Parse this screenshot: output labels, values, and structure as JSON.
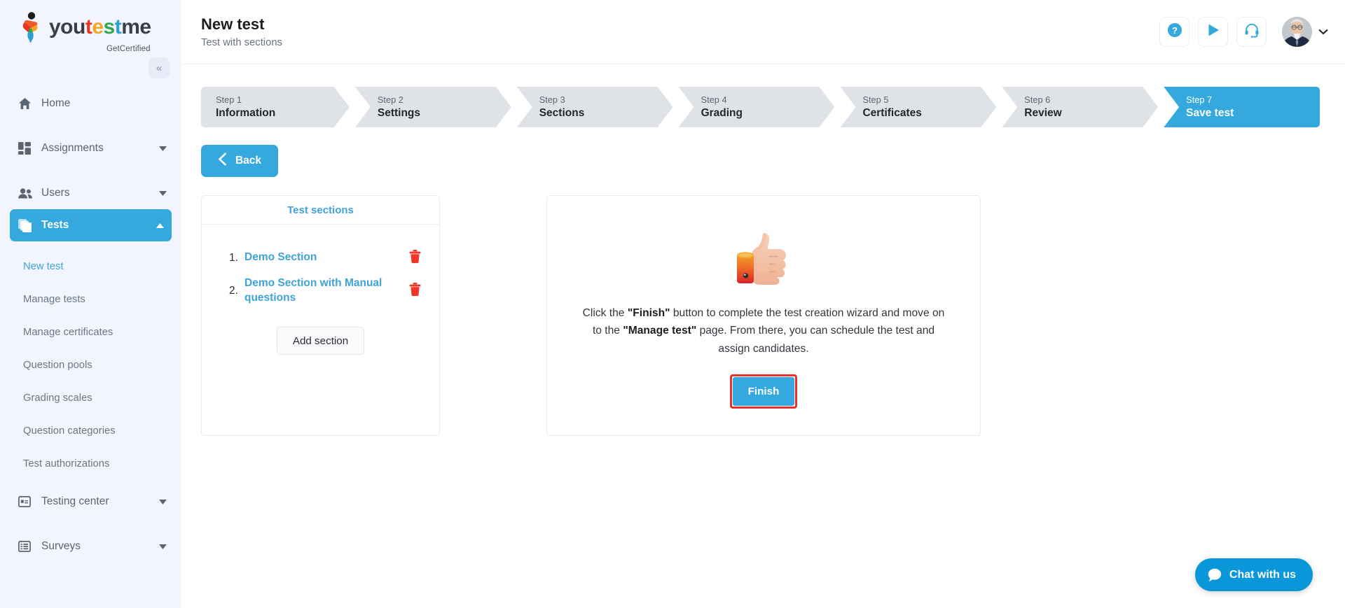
{
  "brand": {
    "name_parts": [
      {
        "text": "you",
        "color": "#3b3f45"
      },
      {
        "text": "t",
        "color": "#ea3323"
      },
      {
        "text": "e",
        "color": "#f5a623"
      },
      {
        "text": "s",
        "color": "#2fa84f"
      },
      {
        "text": "t",
        "color": "#2e9fd4"
      },
      {
        "text": "me",
        "color": "#3b3f45"
      }
    ],
    "tagline": "GetCertified",
    "collapse_icon": "chevron-double-left-icon"
  },
  "sidebar": {
    "items": [
      {
        "label": "Home",
        "icon": "home-icon",
        "has_caret": false,
        "active": false
      },
      {
        "label": "Assignments",
        "icon": "assignments-grid-icon",
        "has_caret": true,
        "active": false
      },
      {
        "label": "Users",
        "icon": "users-icon",
        "has_caret": true,
        "active": false
      },
      {
        "label": "Tests",
        "icon": "tests-stack-icon",
        "has_caret": true,
        "active": true
      }
    ],
    "sub_items": [
      {
        "label": "New test",
        "selected": true
      },
      {
        "label": "Manage tests",
        "selected": false
      },
      {
        "label": "Manage certificates",
        "selected": false
      },
      {
        "label": "Question pools",
        "selected": false
      },
      {
        "label": "Grading scales",
        "selected": false
      },
      {
        "label": "Question categories",
        "selected": false
      },
      {
        "label": "Test authorizations",
        "selected": false
      }
    ],
    "bottom_items": [
      {
        "label": "Testing center",
        "icon": "testing-center-icon",
        "has_caret": true
      },
      {
        "label": "Surveys",
        "icon": "surveys-list-icon",
        "has_caret": true
      }
    ]
  },
  "header": {
    "title": "New test",
    "subtitle": "Test with sections",
    "actions": [
      {
        "name": "help-icon",
        "tooltip": "Help"
      },
      {
        "name": "play-icon",
        "tooltip": "Play tutorial"
      },
      {
        "name": "headset-support-icon",
        "tooltip": "Support"
      }
    ],
    "avatar": {
      "name": "user-avatar",
      "caret": "chevron-down-icon"
    }
  },
  "wizard": {
    "steps": [
      {
        "num": "Step 1",
        "label": "Information",
        "active": false
      },
      {
        "num": "Step 2",
        "label": "Settings",
        "active": false
      },
      {
        "num": "Step 3",
        "label": "Sections",
        "active": false
      },
      {
        "num": "Step 4",
        "label": "Grading",
        "active": false
      },
      {
        "num": "Step 5",
        "label": "Certificates",
        "active": false
      },
      {
        "num": "Step 6",
        "label": "Review",
        "active": false
      },
      {
        "num": "Step 7",
        "label": "Save test",
        "active": true
      }
    ],
    "back_label": "Back"
  },
  "sections_panel": {
    "title": "Test sections",
    "rows": [
      {
        "num": "1.",
        "name": "Demo Section",
        "delete_icon": "trash-icon"
      },
      {
        "num": "2.",
        "name": "Demo Section with Manual questions",
        "delete_icon": "trash-icon"
      }
    ],
    "add_label": "Add section"
  },
  "finish_panel": {
    "illustration": "thumbs-up-emoji",
    "text_part1": "Click the ",
    "text_bold1": "\"Finish\"",
    "text_part2": " button to complete the test creation wizard and move on to the ",
    "text_bold2": "\"Manage test\"",
    "text_part3": " page. From there, you can schedule the test and assign candidates.",
    "button_label": "Finish",
    "button_highlight_color": "#e8312b"
  },
  "chat": {
    "label": "Chat with us",
    "icon": "chat-bubble-icon",
    "color": "#0a97d9"
  },
  "colors": {
    "accent": "#35a8dd",
    "sidebar_bg": "#f2f5fd",
    "step_inactive": "#dfe3e8",
    "link": "#3ea3d8",
    "danger": "#f0362b"
  }
}
